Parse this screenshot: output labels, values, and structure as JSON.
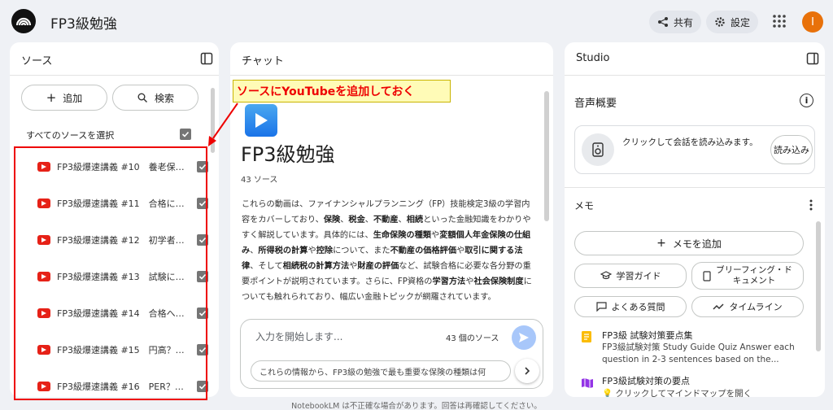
{
  "app": {
    "title": "FP3級勉強"
  },
  "topbar": {
    "share_label": "共有",
    "settings_label": "設定",
    "avatar_initial": "I"
  },
  "sources": {
    "title": "ソース",
    "add_label": "追加",
    "search_label": "検索",
    "select_all_label": "すべてのソースを選択",
    "items": [
      {
        "label": "FP3級爆速講義 #10　養老保…"
      },
      {
        "label": "FP3級爆速講義 #11　合格に…"
      },
      {
        "label": "FP3級爆速講義 #12　初学者…"
      },
      {
        "label": "FP3級爆速講義 #13　試験に…"
      },
      {
        "label": "FP3級爆速講義 #14　合格へ…"
      },
      {
        "label": "FP3級爆速講義 #15　円高？…"
      },
      {
        "label": "FP3級爆速講義 #16　PER？…"
      }
    ]
  },
  "annotation": {
    "callout": "ソースにYouTubeを追加しておく"
  },
  "chat": {
    "title": "チャット",
    "notebook_title": "FP3級勉強",
    "source_count": "43 ソース",
    "summary_parts": [
      {
        "t": "これらの動画は、ファイナンシャルプランニング（FP）技能検定3級の学習内容をカバーしており、",
        "b": false
      },
      {
        "t": "保険",
        "b": true
      },
      {
        "t": "、",
        "b": false
      },
      {
        "t": "税金",
        "b": true
      },
      {
        "t": "、",
        "b": false
      },
      {
        "t": "不動産",
        "b": true
      },
      {
        "t": "、",
        "b": false
      },
      {
        "t": "相続",
        "b": true
      },
      {
        "t": "といった金融知識をわかりやすく解説しています。具体的には、",
        "b": false
      },
      {
        "t": "生命保険の種類",
        "b": true
      },
      {
        "t": "や",
        "b": false
      },
      {
        "t": "変額個人年金保険の仕組み",
        "b": true
      },
      {
        "t": "、",
        "b": false
      },
      {
        "t": "所得税の計算",
        "b": true
      },
      {
        "t": "や",
        "b": false
      },
      {
        "t": "控除",
        "b": true
      },
      {
        "t": "について、また",
        "b": false
      },
      {
        "t": "不動産の価格評価",
        "b": true
      },
      {
        "t": "や",
        "b": false
      },
      {
        "t": "取引に関する法律",
        "b": true
      },
      {
        "t": "、そして",
        "b": false
      },
      {
        "t": "相続税の計算方法",
        "b": true
      },
      {
        "t": "や",
        "b": false
      },
      {
        "t": "財産の評価",
        "b": true
      },
      {
        "t": "など、試験合格に必要な各分野の重要ポイントが説明されています。さらに、FP資格の",
        "b": false
      },
      {
        "t": "学習方法",
        "b": true
      },
      {
        "t": "や",
        "b": false
      },
      {
        "t": "社会保険制度",
        "b": true
      },
      {
        "t": "についても触れられており、幅広い金融トピックが網羅されています。",
        "b": false
      }
    ],
    "input_placeholder": "入力を開始します...",
    "input_source_count": "43 個のソース",
    "suggestion": "これらの情報から、FP3級の勉強で最も重要な保険の種類は何"
  },
  "studio": {
    "title": "Studio",
    "audio_overview_label": "音声概要",
    "audio_card_text": "クリックして会話を読み込みます。",
    "load_label": "読み込み",
    "memo_label": "メモ",
    "add_memo_label": "メモを追加",
    "study_guide_label": "学習ガイド",
    "briefing_label": "ブリーフィング・ドキュメント",
    "faq_label": "よくある質問",
    "timeline_label": "タイムライン",
    "notes": [
      {
        "title": "FP3級 試験対策要点集",
        "subtitle": "FP3級試験対策 Study Guide Quiz Answer each question in 2-3 sentences based on the..."
      },
      {
        "title": "FP3級試験対策の要点",
        "subtitle": "クリックしてマインドマップを開く"
      }
    ]
  },
  "footer": {
    "disclaimer": "NotebookLM は不正確な場合があります。回答は再確認してください。"
  },
  "colors": {
    "accent": "#a8c7fa",
    "youtube": "#e62117",
    "callout_bg": "#fffbb7",
    "annotation_red": "#ee0000"
  }
}
